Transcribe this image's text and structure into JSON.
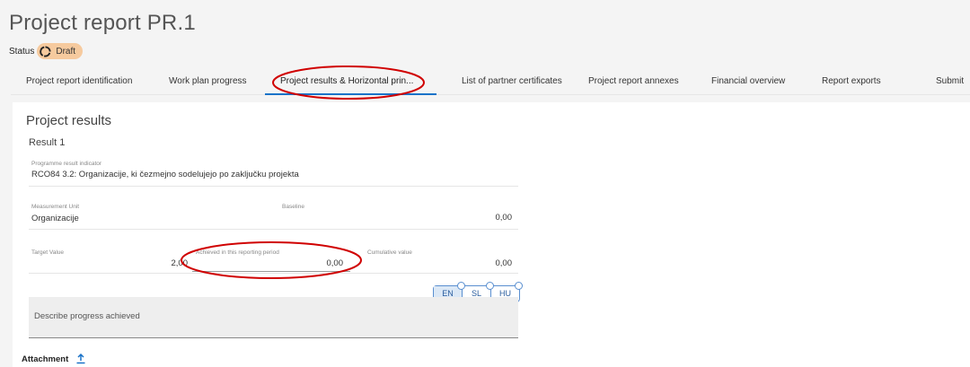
{
  "header": {
    "title": "Project report PR.1",
    "status_label": "Status",
    "status_value": "Draft"
  },
  "tabs": [
    {
      "label": "Project report identification"
    },
    {
      "label": "Work plan progress"
    },
    {
      "label": "Project results & Horizontal prin..."
    },
    {
      "label": "List of partner certificates"
    },
    {
      "label": "Project report annexes"
    },
    {
      "label": "Financial overview"
    },
    {
      "label": "Report exports"
    },
    {
      "label": "Submit"
    }
  ],
  "main": {
    "section_title": "Project results",
    "result_title": "Result 1",
    "indicator_label": "Programme result indicator",
    "indicator_value": "RCO84 3.2: Organizacije, ki čezmejno sodelujejo po zaključku projekta",
    "unit_label": "Measurement Unit",
    "unit_value": "Organizacije",
    "baseline_label": "Baseline",
    "baseline_value": "0,00",
    "target_label": "Target Value",
    "target_value": "2,00",
    "achieved_label": "Achieved in this reporting period",
    "achieved_value": "0,00",
    "cumulative_label": "Cumulative value",
    "cumulative_value": "0,00",
    "languages": [
      "EN",
      "SL",
      "HU"
    ],
    "active_language": "EN",
    "progress_placeholder": "Describe progress achieved",
    "attachment_label": "Attachment"
  },
  "colors": {
    "status_badge": "#f6ca9e",
    "tab_underline": "#1a73c8",
    "annotation": "#d00000"
  },
  "icons": {
    "status": "draft-circle-icon",
    "attachment": "upload-icon"
  }
}
